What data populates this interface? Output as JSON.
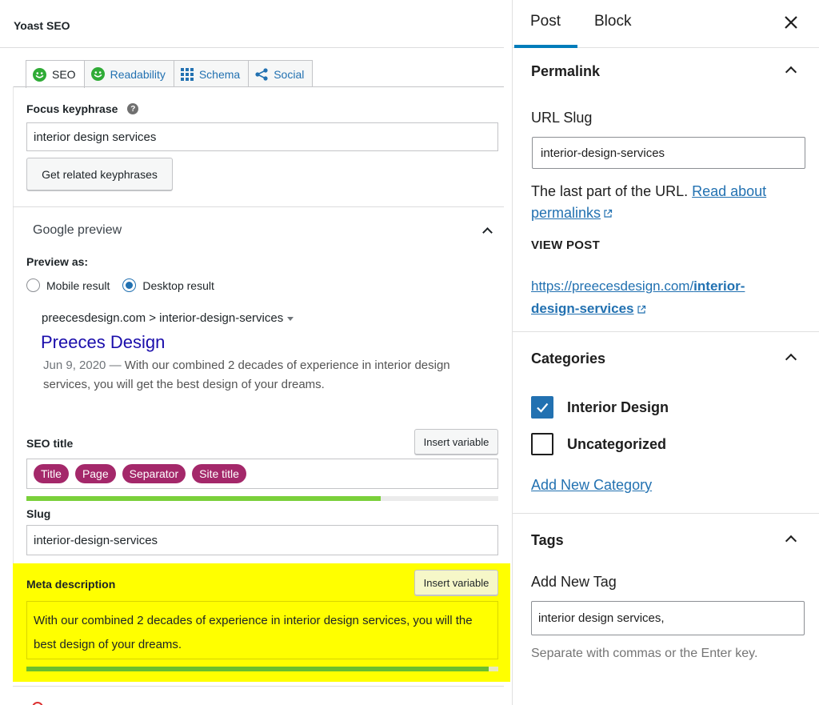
{
  "yoast": {
    "title": "Yoast SEO",
    "tabs": [
      {
        "label": "SEO",
        "icon": "smiley-icon"
      },
      {
        "label": "Readability",
        "icon": "smiley-icon"
      },
      {
        "label": "Schema",
        "icon": "grid-icon"
      },
      {
        "label": "Social",
        "icon": "share-icon"
      }
    ],
    "focus_keyphrase": {
      "label": "Focus keyphrase",
      "help": "?",
      "value": "interior design services",
      "related_button": "Get related keyphrases"
    },
    "google_preview": {
      "title": "Google preview",
      "preview_as_label": "Preview as:",
      "mobile_label": "Mobile result",
      "desktop_label": "Desktop result",
      "selected": "Desktop result",
      "serp_url": "preecesdesign.com > interior-design-services",
      "serp_title": "Preeces Design",
      "serp_date": "Jun 9, 2020 —",
      "serp_desc": "With our combined 2 decades of experience in interior design services, you will get the best design of your dreams."
    },
    "seo_title": {
      "label": "SEO title",
      "insert_button": "Insert variable",
      "pills": [
        "Title",
        "Page",
        "Separator",
        "Site title"
      ],
      "progress": 0.75
    },
    "slug": {
      "label": "Slug",
      "value": "interior-design-services"
    },
    "meta_description": {
      "label": "Meta description",
      "insert_button": "Insert variable",
      "value": "With our combined 2 decades of experience in interior design services, you will the best design of your dreams.",
      "progress": 0.98
    }
  },
  "sidebar": {
    "tabs": [
      "Post",
      "Block"
    ],
    "active_tab": "Post",
    "permalink": {
      "title": "Permalink",
      "url_slug_label": "URL Slug",
      "url_slug_value": "interior-design-services",
      "help_text": "The last part of the URL.",
      "help_link_1": "Read about",
      "help_link_2": "permalinks",
      "view_post_label": "VIEW POST",
      "view_post_url_base": "https://preecesdesign.com/",
      "view_post_url_slug_1": "interior-",
      "view_post_url_slug_2": "design-services"
    },
    "categories": {
      "title": "Categories",
      "items": [
        {
          "label": "Interior Design",
          "checked": true
        },
        {
          "label": "Uncategorized",
          "checked": false
        }
      ],
      "add_link": "Add New Category"
    },
    "tags": {
      "title": "Tags",
      "add_label": "Add New Tag",
      "value": "interior design services,",
      "hint": "Separate with commas or the Enter key."
    }
  },
  "colors": {
    "accent": "#2271b1",
    "pill": "#a4286a",
    "progress_green": "#7ad03a",
    "highlight": "#ffff00",
    "smiley_green": "#2fab36"
  }
}
